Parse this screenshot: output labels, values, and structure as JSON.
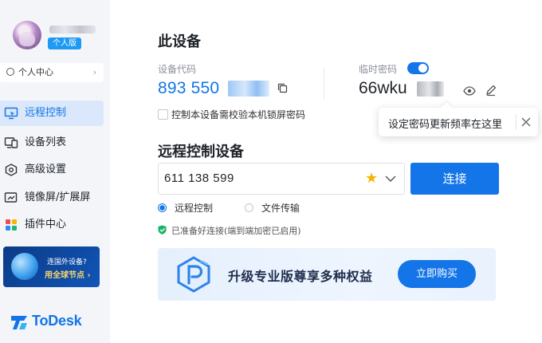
{
  "sidebar": {
    "badge": "个人版",
    "personal_center": {
      "label": "个人中心",
      "chevron": "›"
    },
    "nav": [
      {
        "label": "远程控制",
        "icon": "monitor-icon",
        "active": true
      },
      {
        "label": "设备列表",
        "icon": "devices-icon",
        "active": false
      },
      {
        "label": "高级设置",
        "icon": "hexagon-settings-icon",
        "active": false
      },
      {
        "label": "镜像屏/扩展屏",
        "icon": "mirror-screen-icon",
        "active": false
      },
      {
        "label": "插件中心",
        "icon": "plugins-icon",
        "active": false
      }
    ],
    "promo": {
      "line1": "连国外设备?",
      "line2": "用全球节点 ›"
    },
    "logo": "ToDesk"
  },
  "this_device": {
    "title": "此设备",
    "code_label": "设备代码",
    "code_value": "893 550",
    "temp_password_label": "临时密码",
    "temp_password_enabled": true,
    "temp_password_value": "66wku",
    "lock_check_label": "控制本设备需校验本机锁屏密码",
    "lock_check_checked": false
  },
  "tooltip": {
    "text": "设定密码更新频率在这里"
  },
  "remote": {
    "title": "远程控制设备",
    "input_value": "611 138 599",
    "favorite_glyph": "★",
    "connect_label": "连接",
    "modes": [
      {
        "label": "远程控制",
        "selected": true
      },
      {
        "label": "文件传输",
        "selected": false
      }
    ],
    "status": "已准备好连接(端到端加密已启用)"
  },
  "banner": {
    "text": "升级专业版尊享多种权益",
    "button": "立即购买"
  },
  "colors": {
    "accent": "#1475e8",
    "sidebar_bg": "#f3f5f9",
    "promo_text": "#ffd767",
    "badge": "#1e9af3",
    "status_ok": "#19b36b"
  }
}
